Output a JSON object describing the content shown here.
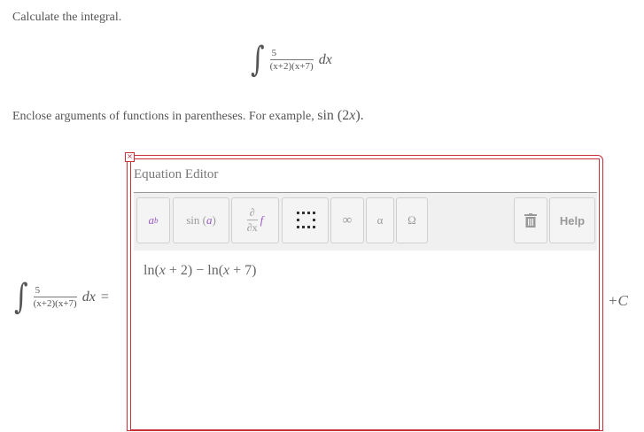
{
  "prompt": "Calculate the integral.",
  "integral": {
    "sign": "∫",
    "numerator": "5",
    "denominator": "(x+2)(x+7)",
    "differential": "dx",
    "equals": "="
  },
  "instruction": {
    "text": "Enclose arguments of functions in parentheses. For example,",
    "example": "sin (2x).",
    "example_parts": {
      "fn": "sin",
      "open": " (2",
      "var": "x",
      "close": ")."
    }
  },
  "editor": {
    "title": "Equation Editor",
    "answer": "ln(x + 2) − ln(x + 7)",
    "answer_parts": {
      "p1": "ln(",
      "v1": "x",
      "p2": " + 2) − ln(",
      "v2": "x",
      "p3": " + 7)"
    },
    "buttons": {
      "power": {
        "base": "a",
        "exp": "b"
      },
      "function": {
        "fn": "sin",
        "arg": "a"
      },
      "derivative": {
        "top": "∂",
        "bottom": "∂x",
        "fn": "f"
      },
      "matrix": "⠿",
      "infinity": "∞",
      "greek": "α",
      "symbols": "Ω",
      "trash": "trash-icon",
      "help": "Help"
    }
  },
  "constant": "+C",
  "close_glyph": "×",
  "colors": {
    "frame": "#c9303a",
    "accent": "#9b59c5",
    "toolbar": "#f0f0f0"
  }
}
